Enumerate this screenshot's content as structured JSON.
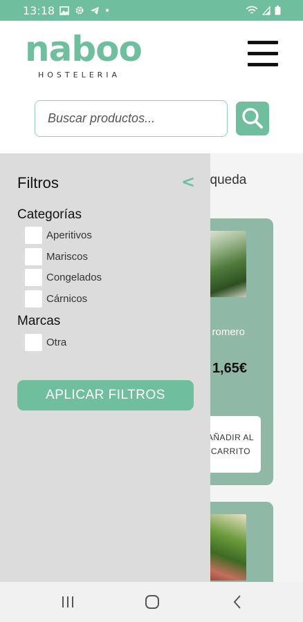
{
  "status_bar": {
    "time": "13:18",
    "icons_left": [
      "image-icon",
      "gear-icon",
      "telegram-icon",
      "dot-icon"
    ],
    "icons_right": [
      "wifi-icon",
      "signal-icon",
      "battery-icon"
    ]
  },
  "header": {
    "logo_text": "naboo",
    "logo_subtitle": "HOSTELERIA",
    "menu_icon": "hamburger-menu-icon"
  },
  "search": {
    "placeholder": "Buscar productos...",
    "value": "",
    "button_icon": "search-icon"
  },
  "content": {
    "results_text_partial": "squeda",
    "products": [
      {
        "name_partial": "romero",
        "price_partial": "1,65€",
        "add_button": "AÑADIR AL CARRITO",
        "image": "rosemary-plant-image"
      },
      {
        "image": "laurel-plant-image"
      }
    ]
  },
  "filters": {
    "title": "Filtros",
    "close_icon": "chevron-left-icon",
    "categories_title": "Categorías",
    "categories": [
      {
        "label": "Aperitivos",
        "checked": false
      },
      {
        "label": "Mariscos",
        "checked": false
      },
      {
        "label": "Congelados",
        "checked": false
      },
      {
        "label": "Cárnicos",
        "checked": false
      }
    ],
    "brands_title": "Marcas",
    "brands": [
      {
        "label": "Otra",
        "checked": false
      }
    ],
    "apply_label": "APLICAR FILTROS"
  },
  "nav_bar": {
    "recents_icon": "recent-apps-icon",
    "home_icon": "home-icon",
    "back_icon": "back-icon"
  },
  "colors": {
    "accent": "#6fbf9f",
    "card": "#8fb8a6",
    "drawer": "#dcdcdc"
  }
}
